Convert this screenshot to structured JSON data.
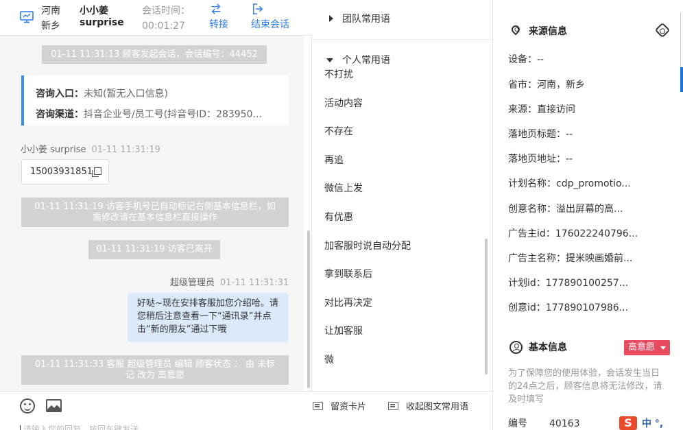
{
  "header": {
    "location": "河南\n新乡",
    "name": "小小姜\nsurprise",
    "session_time_label": "会话时间：",
    "session_time": "00:01:27",
    "transfer_label": "转接",
    "end_label": "结束会话"
  },
  "chat": {
    "sys_start": "01-11 11:31:13 顾客发起会话，会话编号：44452",
    "entry_label": "咨询入口：",
    "entry_value": "未知(暂无入口信息)",
    "channel_label": "咨询渠道：",
    "channel_value": "抖音企业号/员工号(抖音号ID：283950...",
    "visitor_name": "小小姜 surprise",
    "visitor_time": "01-11 11:31:19",
    "phone": "15003931851",
    "sys_phone": "01-11 11:31:19 访客手机号已自动标记右侧基本信息栏，如需修改请在基本信息栏直接操作",
    "sys_left": "01-11 11:31:19 访客已离开",
    "agent_name": "超级管理员",
    "agent_time": "01-11 11:31:31",
    "agent_msg": "好哒~现在安排客服加您介绍哈。请您稍后注意查看一下“通讯录”并点击“新的朋友”通过下哦",
    "sys_status": "01-11 11:31:33 客服 超级管理员 编辑 顾客状态 ： 由 未标记 改为 高意愿"
  },
  "composer": {
    "card_label": "留资卡片",
    "collapse_label": "收起图文常用语",
    "placeholder": "请输入您的回复，按回车键发送"
  },
  "phrases": {
    "team_title": "团队常用语",
    "personal_title": "个人常用语",
    "items": [
      "不打扰",
      "活动内容",
      "不存在",
      "再追",
      "微信上发",
      "有优惠",
      "加客服时说自动分配",
      "拿到联系后",
      "对比再决定",
      "让加客服",
      "微"
    ]
  },
  "source": {
    "title": "来源信息",
    "rows": [
      "设备：--",
      "省市：河南，新乡",
      "来源：直接访问",
      "落地页标题：--",
      "落地页地址：--",
      "计划名称：cdp_promotio...",
      "创意名称：溢出屏幕的高...",
      "广告主id：176022240796...",
      "广告主名称：提米映画婚前...",
      "计划id：177890100257...",
      "创意id：177890107986..."
    ]
  },
  "basic": {
    "title": "基本信息",
    "badge": "高意愿",
    "note": "为了保障您的使用体验，会话发生当日的24点之后，顾客信息将无法修改，请及时填写",
    "id_label": "编号",
    "id_value": "40163"
  },
  "ime": {
    "logo": "S",
    "text": "中 °,"
  },
  "colors": {
    "accent": "#2d7be5",
    "bubble": "#dce9fb",
    "badge": "#e84a5f",
    "system_msg": "#d2d2d2"
  }
}
